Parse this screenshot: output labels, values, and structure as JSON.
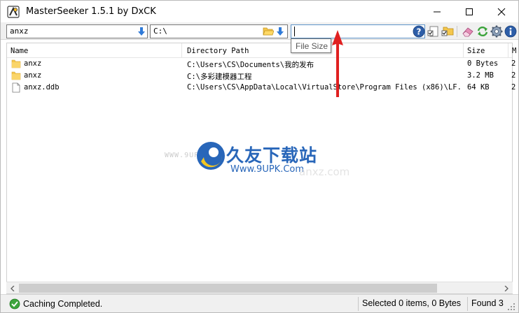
{
  "window": {
    "title": "MasterSeeker 1.5.1 by DxCK"
  },
  "toolbar": {
    "name_filter_value": "anxz",
    "path_value": "C:\\",
    "search_value": "",
    "tooltip": "File Size"
  },
  "list": {
    "columns": [
      "Name",
      "Directory Path",
      "Size",
      "M"
    ],
    "rows": [
      {
        "icon": "folder-icon",
        "name": "anxz",
        "dir": "C:\\Users\\CS\\Documents\\我的发布",
        "size": "0 Bytes",
        "more": "2"
      },
      {
        "icon": "folder-icon",
        "name": "anxz",
        "dir": "C:\\多彩建模器工程",
        "size": "3.2 MB",
        "more": "2"
      },
      {
        "icon": "file-icon",
        "name": "anxz.ddb",
        "dir": "C:\\Users\\CS\\AppData\\Local\\VirtualStore\\Program Files (x86)\\LF...",
        "size": "64 KB",
        "more": "2"
      }
    ]
  },
  "status": {
    "message": "Caching Completed.",
    "selected": "Selected 0 items, 0 Bytes",
    "found": "Found 3"
  },
  "watermark": {
    "small": "WWW.9UPK.COM",
    "cn": "久友下载站",
    "url": "Www.9UPK.Com",
    "faint": "anxz.com"
  },
  "colors": {
    "accent_blue": "#1d5eb6",
    "arrow_red": "#e02020",
    "folder_yellow": "#f5c74c"
  }
}
